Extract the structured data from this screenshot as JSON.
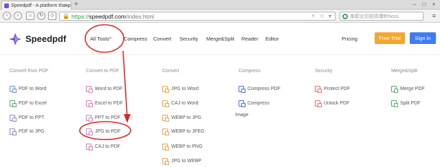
{
  "browser": {
    "tab_title": "Speedpdf - A platform that p",
    "tab_close": "×",
    "new_tab": "+",
    "window_buttons": [
      "–",
      "□",
      "×"
    ],
    "url_scheme": "https://",
    "url_host": "speedpdf.com",
    "url_path": "/index.html",
    "search_placeholder": "单职业切割高爆秒boss",
    "icons": [
      "back-icon",
      "forward-icon",
      "home-icon",
      "refresh-icon",
      "lock-icon",
      "star-icon",
      "menu-icon"
    ]
  },
  "site": {
    "logo": "Speedpdf",
    "nav": {
      "all_tools": "All Tools",
      "compress": "Compress",
      "convert": "Convert",
      "security": "Security",
      "merge_split": "Merge&Split",
      "reader": "Reader",
      "editor": "Editor",
      "pricing": "Pricing"
    },
    "free_trial": "Free Trial",
    "sign_in": "Sign in"
  },
  "menu": {
    "categories": [
      {
        "title": "Convert from PDF",
        "items": [
          "PDF to Word",
          "PDF to Excel",
          "PDF to PPT",
          "PDF to JPG"
        ]
      },
      {
        "title": "Convert to PDF",
        "items": [
          "Word to PDF",
          "Excel to PDF",
          "PPT to PDF",
          "JPG to PDF",
          "CAJ to PDF"
        ]
      },
      {
        "title": "Convert",
        "items": [
          "JPG to Word",
          "CAJ to Word",
          "WEBP to JPG",
          "WEBP to JPEG",
          "WEBP to PNG",
          "JPG to WEBP"
        ]
      },
      {
        "title": "Compress",
        "items": [
          "Compress PDF",
          "Compress"
        ],
        "extra": "Image"
      },
      {
        "title": "Security",
        "items": [
          "Protect PDF",
          "Unlock PDF"
        ]
      },
      {
        "title": "Merge&Split",
        "items": [
          "Merge PDF",
          "Split PDF"
        ]
      }
    ]
  },
  "colors": {
    "accent_orange": "#f7a531",
    "accent_blue": "#3f7cf4",
    "annotation_red": "#e02424",
    "logo_purple": "#7a4fd6"
  }
}
